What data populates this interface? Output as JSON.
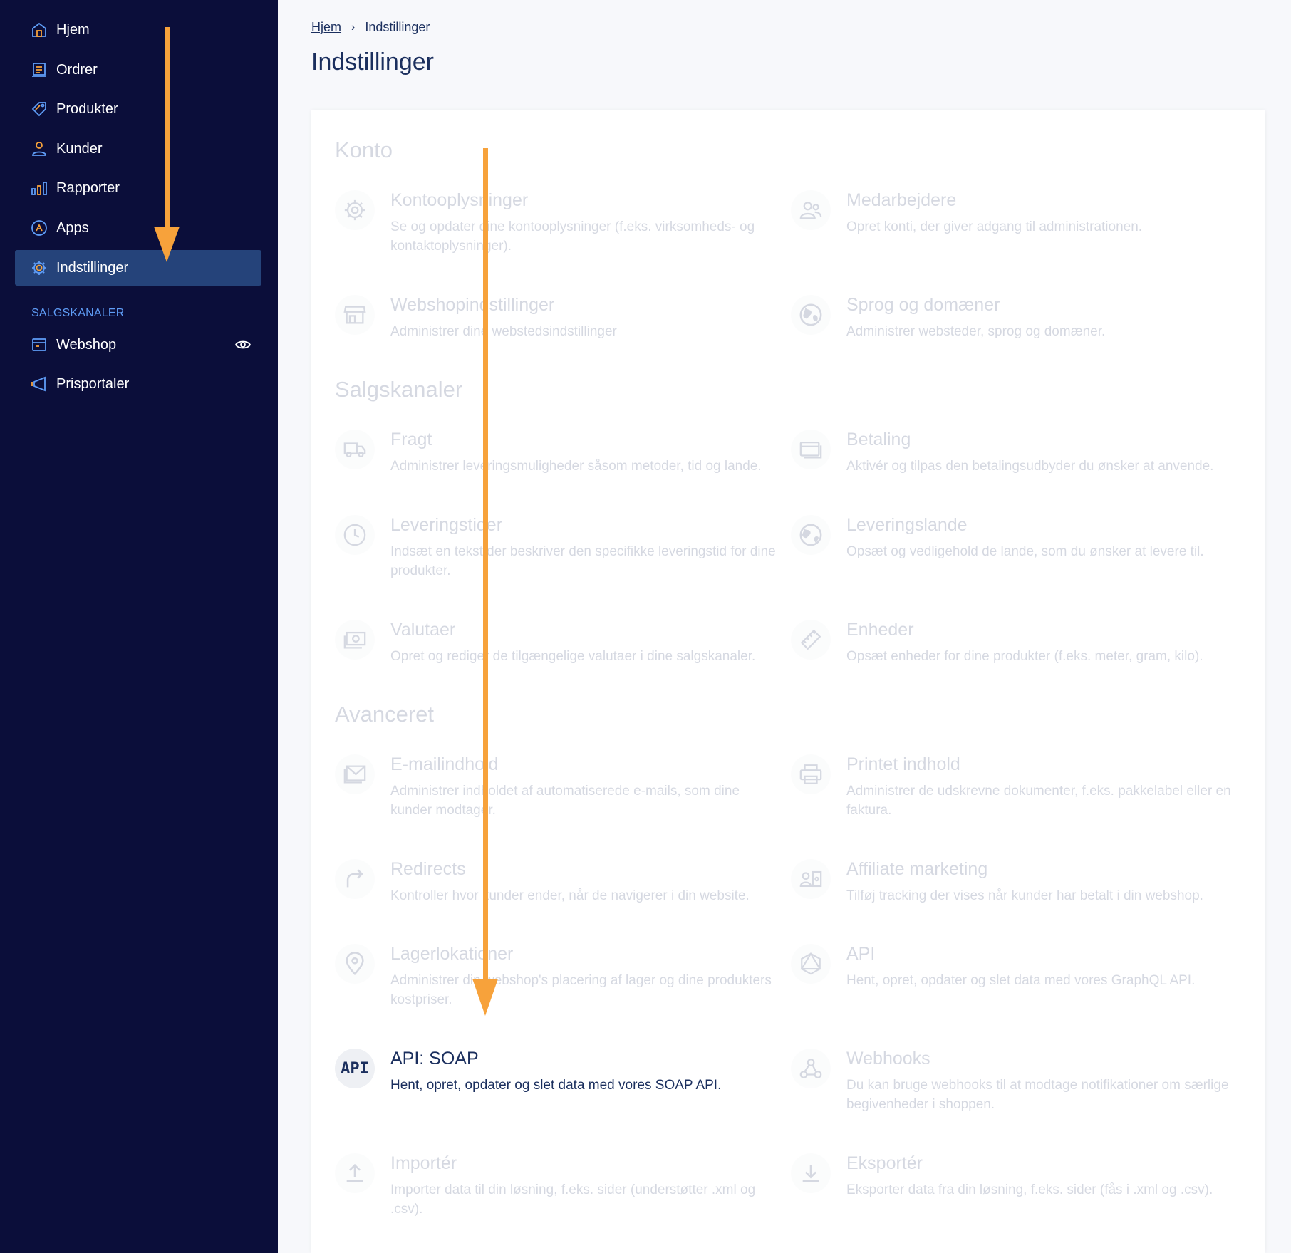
{
  "sidebar": {
    "items": [
      {
        "label": "Hjem",
        "icon": "home-icon"
      },
      {
        "label": "Ordrer",
        "icon": "orders-icon"
      },
      {
        "label": "Produkter",
        "icon": "tag-icon"
      },
      {
        "label": "Kunder",
        "icon": "user-icon"
      },
      {
        "label": "Rapporter",
        "icon": "bar-chart-icon"
      },
      {
        "label": "Apps",
        "icon": "apps-icon"
      },
      {
        "label": "Indstillinger",
        "icon": "gear-icon",
        "active": true
      }
    ],
    "section_label": "SALGSKANALER",
    "channels": [
      {
        "label": "Webshop",
        "icon": "webshop-icon"
      },
      {
        "label": "Prisportaler",
        "icon": "megaphone-icon"
      }
    ]
  },
  "breadcrumb": {
    "home": "Hjem",
    "current": "Indstillinger"
  },
  "page_title": "Indstillinger",
  "sections": {
    "konto": "Konto",
    "salgskanaler": "Salgskanaler",
    "avanceret": "Avanceret"
  },
  "items": {
    "kontooplysninger": {
      "title": "Kontooplysninger",
      "desc": "Se og opdater dine kontooplysninger (f.eks. virksomheds- og kontaktoplysninger).",
      "icon": "gear-icon"
    },
    "medarbejdere": {
      "title": "Medarbejdere",
      "desc": "Opret konti, der giver adgang til administrationen.",
      "icon": "users-icon"
    },
    "webshopindstillinger": {
      "title": "Webshopindstillinger",
      "desc": "Administrer dine webstedsindstillinger",
      "icon": "store-icon"
    },
    "sprog": {
      "title": "Sprog og domæner",
      "desc": "Administrer websteder, sprog og domæner.",
      "icon": "globe-icon"
    },
    "fragt": {
      "title": "Fragt",
      "desc": "Administrer leveringsmuligheder såsom metoder, tid og lande.",
      "icon": "truck-icon"
    },
    "betaling": {
      "title": "Betaling",
      "desc": "Aktivér og tilpas den betalingsudbyder du ønsker at anvende.",
      "icon": "card-icon"
    },
    "leveringstider": {
      "title": "Leveringstider",
      "desc": "Indsæt en tekst der beskriver den specifikke leveringstid for dine produkter.",
      "icon": "clock-icon"
    },
    "leveringslande": {
      "title": "Leveringslande",
      "desc": "Opsæt og vedligehold de lande, som du ønsker at levere til.",
      "icon": "globe-location-icon"
    },
    "valutaer": {
      "title": "Valutaer",
      "desc": "Opret og rediger de tilgængelige valutaer i dine salgskanaler.",
      "icon": "money-icon"
    },
    "enheder": {
      "title": "Enheder",
      "desc": "Opsæt enheder for dine produkter (f.eks. meter, gram, kilo).",
      "icon": "ruler-icon"
    },
    "emailindhold": {
      "title": "E-mailindhold",
      "desc": "Administrer indholdet af automatiserede e-mails, som dine kunder modtager.",
      "icon": "mail-icon"
    },
    "printet": {
      "title": "Printet indhold",
      "desc": "Administrer de udskrevne dokumenter, f.eks. pakkelabel eller en faktura.",
      "icon": "printer-icon"
    },
    "redirects": {
      "title": "Redirects",
      "desc": "Kontroller hvor kunder ender, når de navigerer i din website.",
      "icon": "redirect-icon"
    },
    "affiliate": {
      "title": "Affiliate marketing",
      "desc": "Tilføj tracking der vises når kunder har betalt i din webshop.",
      "icon": "affiliate-icon"
    },
    "lagerlokationer": {
      "title": "Lagerlokationer",
      "desc": "Administrer din webshop's placering af lager og dine produkters kostpriser.",
      "icon": "location-pin-icon"
    },
    "api": {
      "title": "API",
      "desc": "Hent, opret, opdater og slet data med vores GraphQL API.",
      "icon": "graphql-icon"
    },
    "api_soap": {
      "title": "API: SOAP",
      "desc": "Hent, opret, opdater og slet data med vores SOAP API.",
      "icon": "api-icon",
      "icon_text": "API"
    },
    "webhooks": {
      "title": "Webhooks",
      "desc": "Du kan bruge webhooks til at modtage notifikationer om særlige begivenheder i shoppen.",
      "icon": "webhook-icon"
    },
    "importer": {
      "title": "Importér",
      "desc": "Importer data til din løsning, f.eks. sider (understøtter .xml og .csv).",
      "icon": "upload-icon"
    },
    "eksporter": {
      "title": "Eksportér",
      "desc": "Eksporter data fra din løsning, f.eks. sider (fås i .xml og .csv).",
      "icon": "download-icon"
    }
  },
  "colors": {
    "sidebar_bg": "#0b0e3a",
    "active_bg": "#25437a",
    "text_primary": "#1b2f5e",
    "accent_blue": "#5f9df7",
    "icon_orange": "#f7a23b",
    "arrow": "#f7a23b"
  }
}
